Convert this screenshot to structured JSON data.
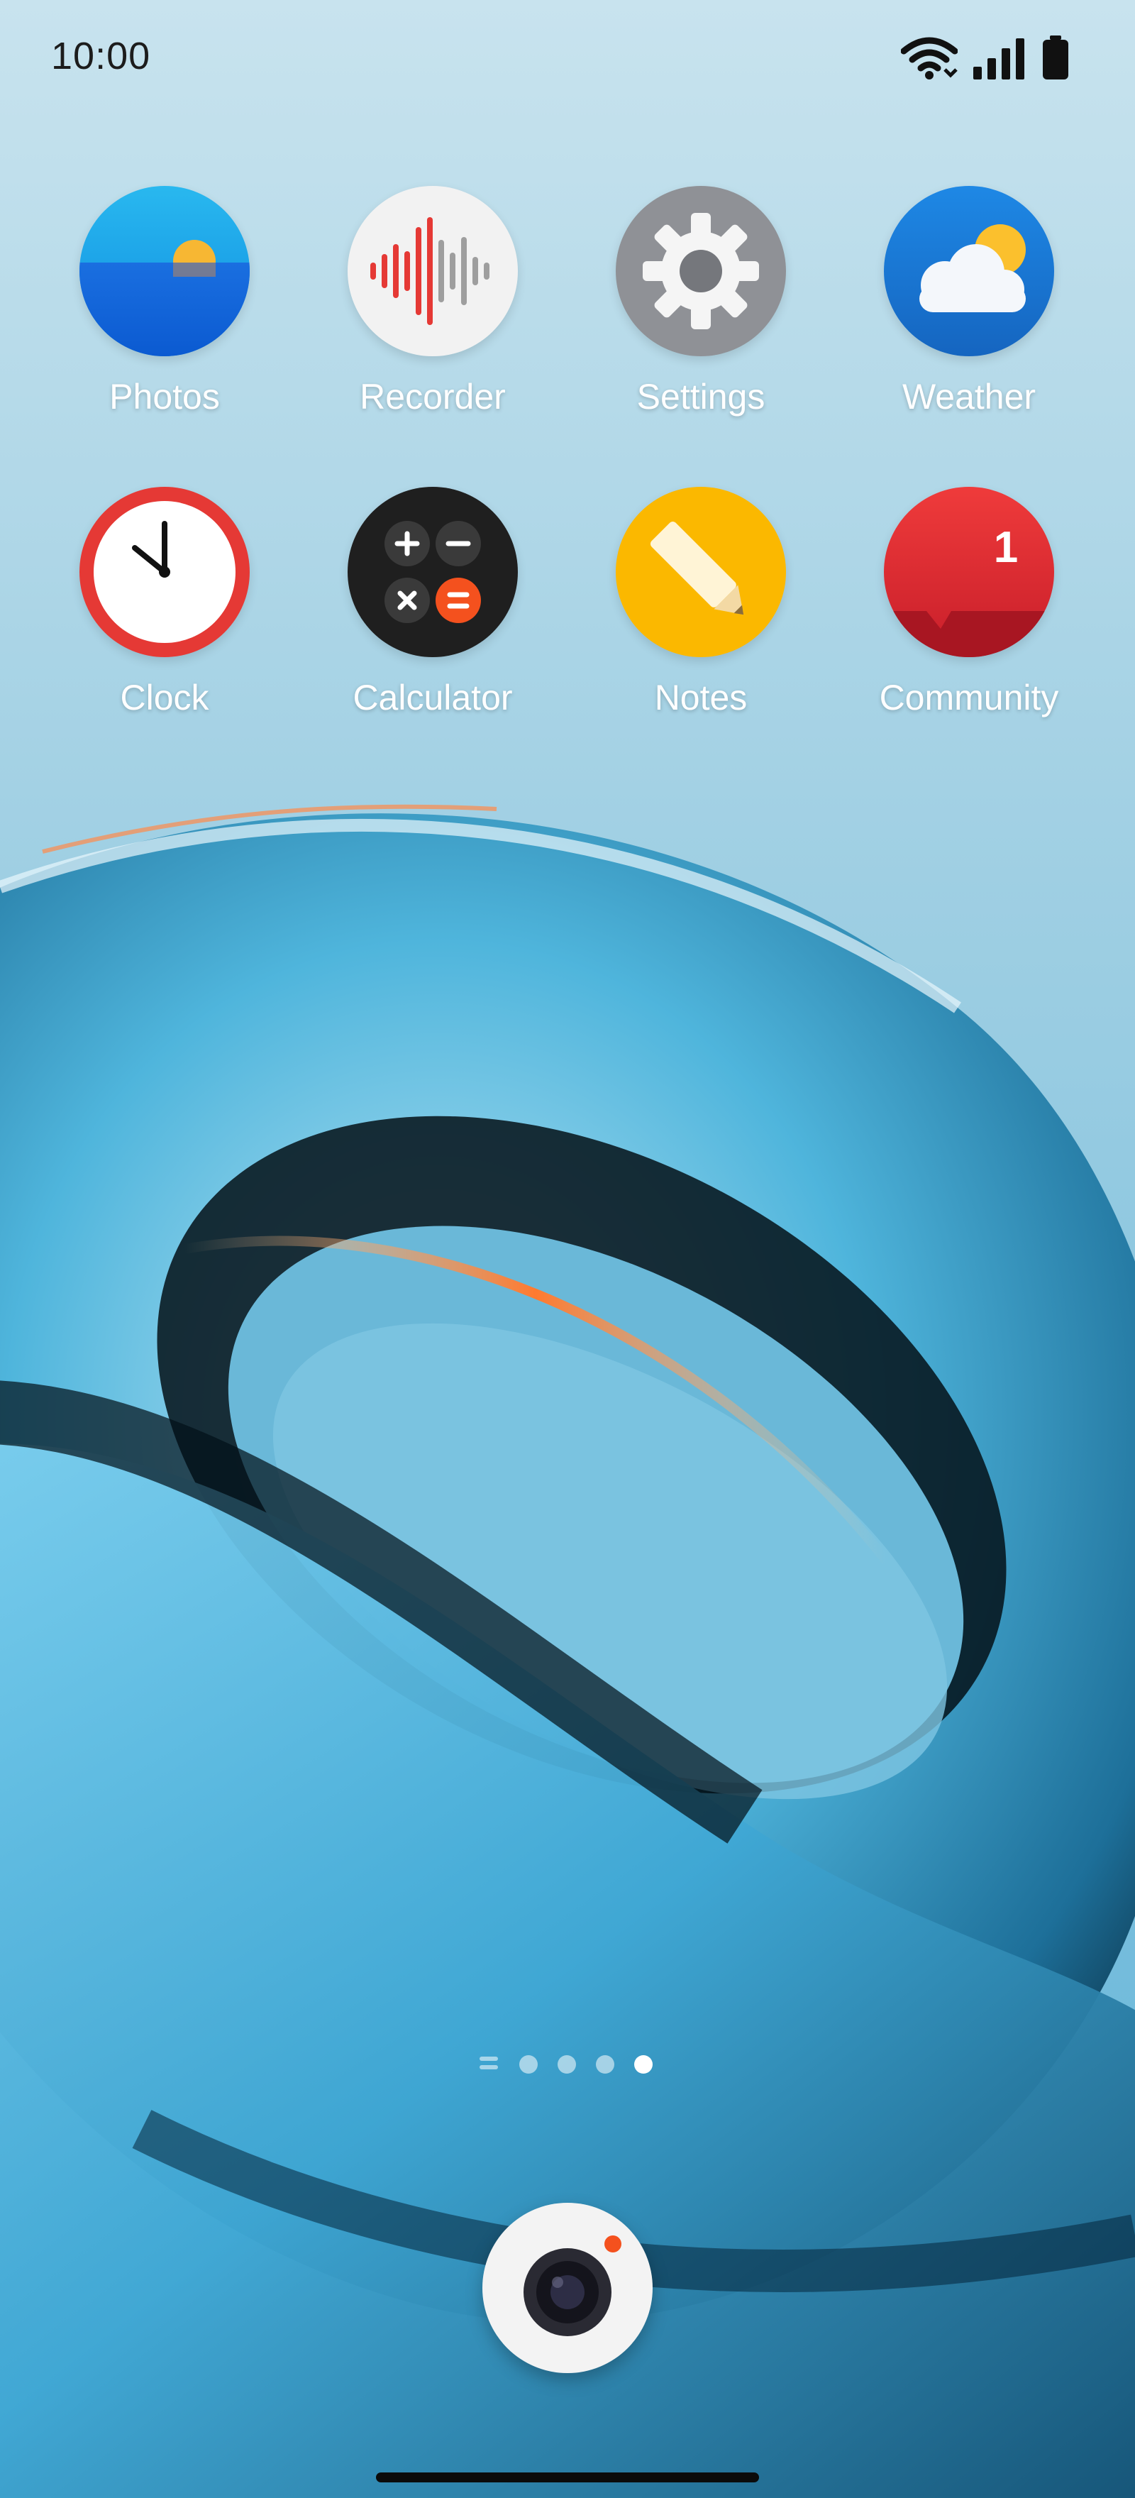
{
  "status_bar": {
    "time": "10:00",
    "icons": [
      "wifi-icon",
      "signal-icon",
      "battery-icon"
    ]
  },
  "apps": [
    {
      "label": "Photos",
      "icon": "photos-icon"
    },
    {
      "label": "Recorder",
      "icon": "recorder-icon"
    },
    {
      "label": "Settings",
      "icon": "settings-gear-icon"
    },
    {
      "label": "Weather",
      "icon": "weather-icon"
    },
    {
      "label": "Clock",
      "icon": "clock-icon"
    },
    {
      "label": "Calculator",
      "icon": "calculator-icon"
    },
    {
      "label": "Notes",
      "icon": "notes-pencil-icon"
    },
    {
      "label": "Community",
      "icon": "community-icon",
      "badge": "1"
    }
  ],
  "page_indicator": {
    "pages": 5,
    "active_page": 5
  },
  "dock": {
    "app": "Camera",
    "icon": "camera-icon"
  },
  "colors": {
    "label_text": "#ffffff",
    "status_text": "#1c1c1c",
    "wallpaper_base": "#c2e0eb"
  }
}
